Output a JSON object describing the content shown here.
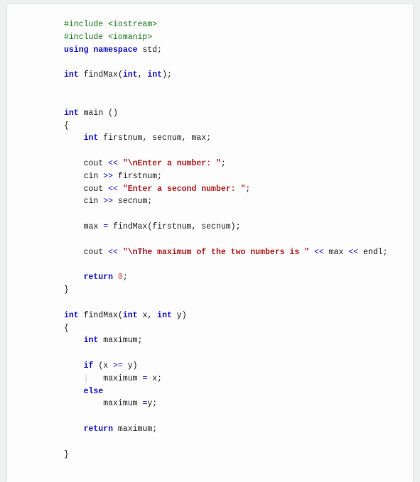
{
  "code": {
    "l01": {
      "pp": "#include <iostream>"
    },
    "l02": {
      "pp": "#include <iomanip>"
    },
    "l03": {
      "kw1": "using",
      "kw2": "namespace",
      "id": "std",
      "semi": ";"
    },
    "l05": {
      "kw1": "int",
      "id": "findMax",
      "lp": "(",
      "kw2": "int",
      "c": ", ",
      "kw3": "int",
      "rp": ");"
    },
    "l08": {
      "kw": "int",
      "id": "main ",
      "paren": "()"
    },
    "l09": {
      "brace": "{"
    },
    "l10": {
      "kw": "int",
      "ids": " firstnum, secnum, max;"
    },
    "l12": {
      "id": "cout ",
      "op": "<<",
      "str": " \"\\nEnter a number: \"",
      "semi": ";"
    },
    "l13": {
      "id1": "cin ",
      "op": ">>",
      "id2": " firstnum;"
    },
    "l14": {
      "id": "cout ",
      "op": "<<",
      "str": " \"Enter a second number: \"",
      "semi": ";"
    },
    "l15": {
      "id1": "cin ",
      "op": ">>",
      "id2": " secnum;"
    },
    "l17": {
      "lhs": "max ",
      "eq": "=",
      "fn": " findMax",
      "args": "(firstnum, secnum);"
    },
    "l19": {
      "id": "cout ",
      "op1": "<<",
      "str": " \"\\nThe maximum of the two numbers is \" ",
      "op2": "<<",
      "mid": " max ",
      "op3": "<<",
      "endl": " endl;"
    },
    "l21": {
      "kw": "return",
      "sp": " ",
      "num": "0",
      "semi": ";"
    },
    "l22": {
      "brace": "}"
    },
    "l24": {
      "kw1": "int",
      "id": " findMax",
      "lp": "(",
      "kw2": "int",
      "x": " x, ",
      "kw3": "int",
      "y": " y)"
    },
    "l25": {
      "brace": "{"
    },
    "l26": {
      "kw": "int",
      "id": " maximum;"
    },
    "l28": {
      "kw": "if",
      "sp": " (x ",
      "op": ">=",
      "rest": " y)"
    },
    "l29": {
      "guide": "|   ",
      "txt": "maximum ",
      "eq": "=",
      "rest": " x;"
    },
    "l30": {
      "kw": "else"
    },
    "l31": {
      "txt": "maximum ",
      "eq": "=",
      "rest": "y;"
    },
    "l33": {
      "kw": "return",
      "id": " maximum;"
    },
    "l35": {
      "brace": "}"
    }
  }
}
